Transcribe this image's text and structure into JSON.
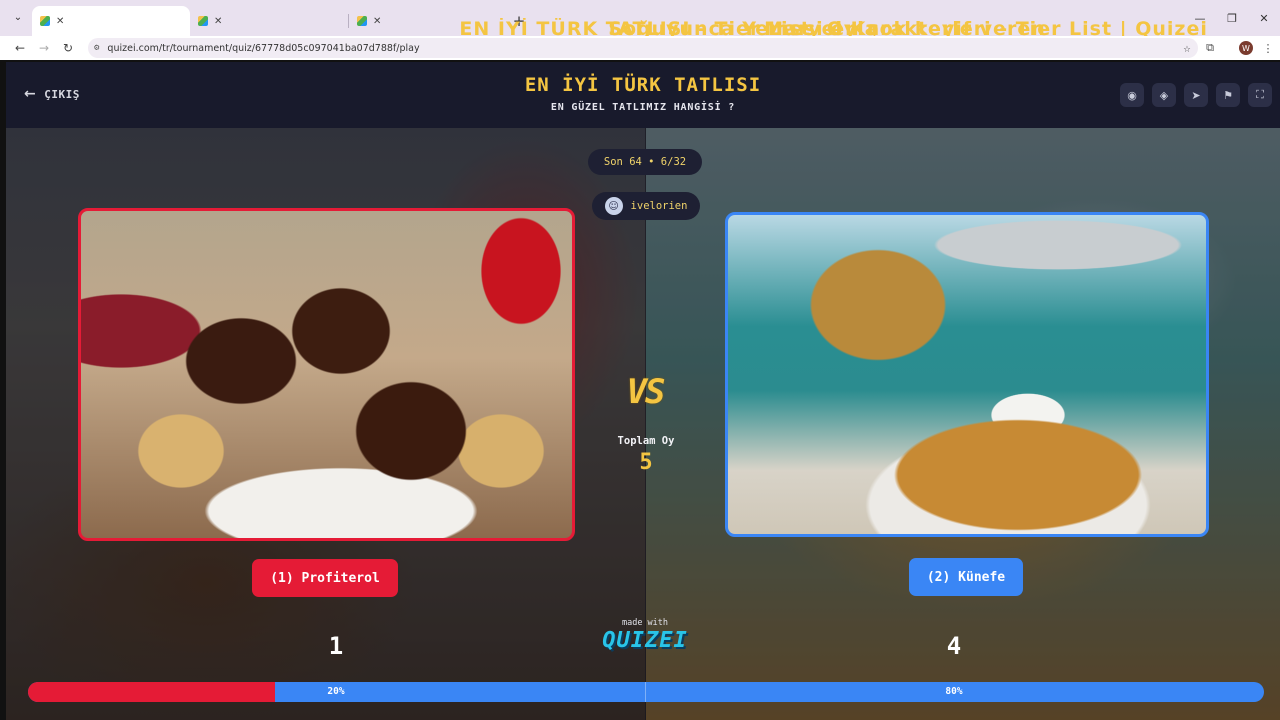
{
  "browser": {
    "tabs": [
      {
        "title": "EN İYİ TÜRK TATLISI - Tier List, Oyla",
        "active": true
      },
      {
        "title": "Soğuyunca Yemesi en çok keyif veren",
        "active": false
      },
      {
        "title": "Marvel Karakterleri - Tier List | Quizei",
        "active": false
      }
    ],
    "url": "quizei.com/tr/tournament/quiz/67778d05c097041ba07d788f/play",
    "avatar_letter": "W"
  },
  "header": {
    "exit_label": "ÇIKIŞ",
    "title": "EN İYİ TÜRK TATLISI",
    "subtitle": "EN GÜZEL TATLIMIZ HANGİSİ ?"
  },
  "round": {
    "label": "Son 64 • 6/32"
  },
  "user": {
    "name": "ivelorien"
  },
  "vs": {
    "text": "VS",
    "total_label": "Toplam Oy",
    "total_value": "5"
  },
  "left": {
    "label": "(1) Profiterol",
    "votes": "1",
    "percent_label": "20%",
    "percent": 20
  },
  "right": {
    "label": "(2) Künefe",
    "votes": "4",
    "percent_label": "80%",
    "percent": 80
  },
  "branding": {
    "made_with": "made with",
    "logo": "QUIZEI"
  },
  "colors": {
    "left": "#e51b36",
    "right": "#3a86f5",
    "accent": "#f4c542",
    "header_bg": "#181a2c"
  }
}
